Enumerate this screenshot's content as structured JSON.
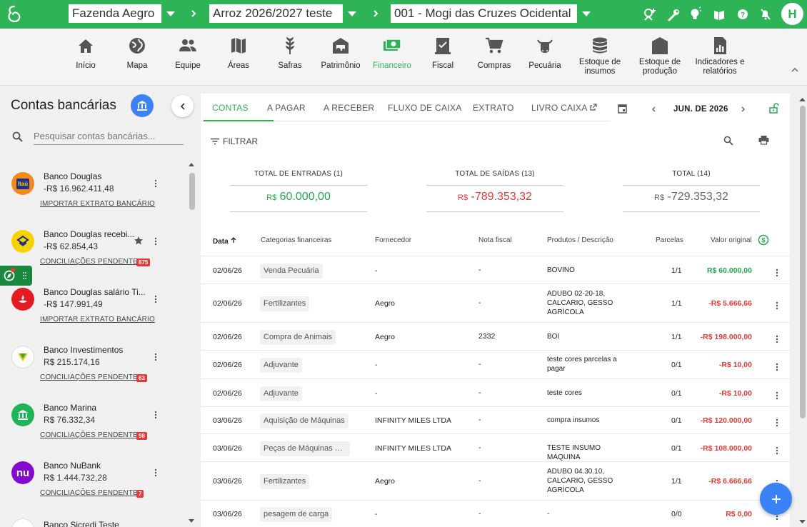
{
  "topbar": {
    "farm": "Fazenda Aegro",
    "harvest": "Arroz 2026/2027 teste",
    "unit": "001 - Mogi das Cruzes Ocidental",
    "avatar": "H"
  },
  "nav": [
    {
      "label": "Início",
      "icon": "home-icon"
    },
    {
      "label": "Mapa",
      "icon": "globe-icon"
    },
    {
      "label": "Equipe",
      "icon": "people-icon"
    },
    {
      "label": "Áreas",
      "icon": "map-icon"
    },
    {
      "label": "Safras",
      "icon": "wheat-icon"
    },
    {
      "label": "Patrimônio",
      "icon": "tractor-icon"
    },
    {
      "label": "Financeiro",
      "icon": "money-icon",
      "active": true
    },
    {
      "label": "Fiscal",
      "icon": "invoice-icon"
    },
    {
      "label": "Compras",
      "icon": "cart-icon"
    },
    {
      "label": "Pecuária",
      "icon": "cow-icon"
    },
    {
      "label": "Estoque de insumos",
      "icon": "database-icon"
    },
    {
      "label": "Estoque de produção",
      "icon": "silo-icon"
    },
    {
      "label": "Indicadores e relatórios",
      "icon": "report-icon"
    }
  ],
  "sidebar": {
    "title": "Contas bancárias",
    "search_placeholder": "Pesquisar contas bancárias...",
    "accounts": [
      {
        "name": "Banco Douglas",
        "balance": "-R$ 16.962.411,48",
        "link": "IMPORTAR EXTRATO BANCÁRIO",
        "badge": "",
        "icon_text": "Itaú",
        "color": "#f28a1c"
      },
      {
        "name": "Banco Douglas recebi...",
        "balance": "-R$ 62.854,43",
        "link": "CONCILIAÇÕES PENDENTES",
        "badge": "875",
        "icon_text": "",
        "color": "#f5d200",
        "star": true
      },
      {
        "name": "Banco Douglas salário Ti...",
        "balance": "-R$ 147.991,49",
        "link": "IMPORTAR EXTRATO BANCÁRIO",
        "badge": "",
        "icon_text": "",
        "color": "#e41b23"
      },
      {
        "name": "Banco Investimentos",
        "balance": "R$ 215.174,16",
        "link": "CONCILIAÇÕES PENDENTES",
        "badge": "63",
        "icon_text": "",
        "color": "#ffffff"
      },
      {
        "name": "Banco Marina",
        "balance": "R$ 76.332,34",
        "link": "CONCILIAÇÕES PENDENTES",
        "badge": "98",
        "icon_text": "",
        "color": "#21b35a"
      },
      {
        "name": "Banco NuBank",
        "balance": "R$ 1.444.732,28",
        "link": "CONCILIAÇÕES PENDENTES",
        "badge": "7",
        "icon_text": "nu",
        "color": "#820ad1"
      },
      {
        "name": "Banco Sicredi Teste",
        "balance": "",
        "link": "",
        "badge": "",
        "icon_text": "",
        "color": "#ffffff"
      }
    ]
  },
  "tabs": [
    "CONTAS",
    "A PAGAR",
    "A RECEBER",
    "FLUXO DE CAIXA",
    "EXTRATO",
    "LIVRO CAIXA"
  ],
  "period": "JUN. DE 2026",
  "filter_label": "FILTRAR",
  "totals": [
    {
      "label": "TOTAL DE ENTRADAS (1)",
      "currency": "R$",
      "value": "60.000,00"
    },
    {
      "label": "TOTAL DE SAÍDAS (13)",
      "currency": "R$",
      "value": "-789.353,32"
    },
    {
      "label": "TOTAL (14)",
      "currency": "R$",
      "value": "-729.353,32"
    }
  ],
  "table": {
    "headers": [
      "Data",
      "Categorias financeiras",
      "Fornecedor",
      "Nota fiscal",
      "Produtos / Descrição",
      "Parcelas",
      "Valor original"
    ],
    "rows": [
      {
        "date": "02/06/26",
        "category": "Venda Pecuária",
        "supplier": "-",
        "invoice": "-",
        "desc": "BOVINO",
        "parcels": "1/1",
        "value": "R$ 60.000,00",
        "positive": true
      },
      {
        "date": "02/06/26",
        "category": "Fertilizantes",
        "supplier": "Aegro",
        "invoice": "-",
        "desc": "ADUBO 02-20-18, CALCARIO, GESSO AGRÍCOLA",
        "parcels": "1/1",
        "value": "-R$ 5.666,66"
      },
      {
        "date": "02/06/26",
        "category": "Compra de Animais",
        "supplier": "Aegro",
        "invoice": "2332",
        "desc": "BOI",
        "parcels": "1/1",
        "value": "-R$ 198.000,00"
      },
      {
        "date": "02/06/26",
        "category": "Adjuvante",
        "supplier": "-",
        "invoice": "-",
        "desc": "teste cores parcelas a pagar",
        "parcels": "0/1",
        "value": "-R$ 10,00"
      },
      {
        "date": "02/06/26",
        "category": "Adjuvante",
        "supplier": "-",
        "invoice": "-",
        "desc": "teste cores",
        "parcels": "0/1",
        "value": "-R$ 10,00"
      },
      {
        "date": "03/06/26",
        "category": "Aquisição de Máquinas",
        "supplier": "INFINITY MILES LTDA",
        "invoice": "-",
        "desc": "compra insumos",
        "parcels": "0/1",
        "value": "-R$ 120.000,00"
      },
      {
        "date": "03/06/26",
        "category": "Peças de Máquinas e Equipamentos",
        "supplier": "INFINITY MILES LTDA",
        "invoice": "-",
        "desc": "TESTE INSUMO MAQUINA",
        "parcels": "0/1",
        "value": "-R$ 108.000,00"
      },
      {
        "date": "03/06/26",
        "category": "Fertilizantes",
        "supplier": "Aegro",
        "invoice": "-",
        "desc": "ADUBO 04.30.10, CALCARIO, GESSO AGRÍCOLA",
        "parcels": "1/1",
        "value": "-R$ 6.666,66"
      },
      {
        "date": "03/06/26",
        "category": "pesagem de carga",
        "supplier": "-",
        "invoice": "-",
        "desc": "-",
        "parcels": "0/0",
        "value": "R$ 0,00"
      }
    ]
  }
}
